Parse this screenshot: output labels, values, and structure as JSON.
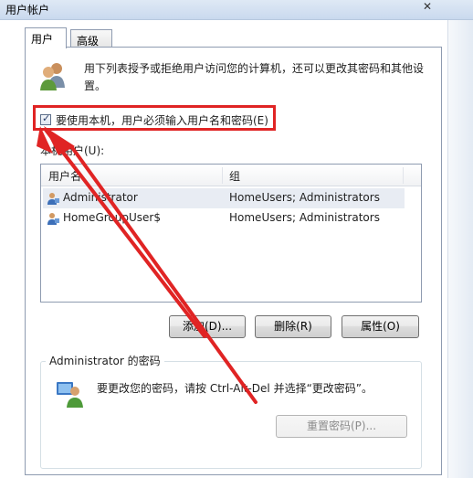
{
  "window": {
    "title": "用户帐户",
    "close_glyph": "✕"
  },
  "tabs": [
    {
      "label": "用户",
      "active": true
    },
    {
      "label": "高级",
      "active": false
    }
  ],
  "intro": {
    "text": "用下列表授予或拒绝用户访问您的计算机，还可以更改其密码和其他设置。",
    "icon": "users-icon"
  },
  "require_login": {
    "label": "要使用本机，用户必须输入用户名和密码(E)",
    "checked": true
  },
  "users_section": {
    "label": "本机用户(U):",
    "columns": [
      "用户名",
      "组"
    ],
    "rows": [
      {
        "name": "Administrator",
        "group": "HomeUsers; Administrators",
        "icon": "user-icon"
      },
      {
        "name": "HomeGroupUser$",
        "group": "HomeUsers; Administrators",
        "icon": "user-icon"
      }
    ]
  },
  "buttons": {
    "add": "添加(D)...",
    "delete": "删除(R)",
    "properties": "属性(O)"
  },
  "password_group": {
    "title": "Administrator 的密码",
    "text": "要更改您的密码，请按 Ctrl-Alt-Del 并选择“更改密码”。",
    "reset_button": "重置密码(P)...",
    "icon": "admin-user-icon"
  },
  "colors": {
    "annotation": "#e02424"
  }
}
